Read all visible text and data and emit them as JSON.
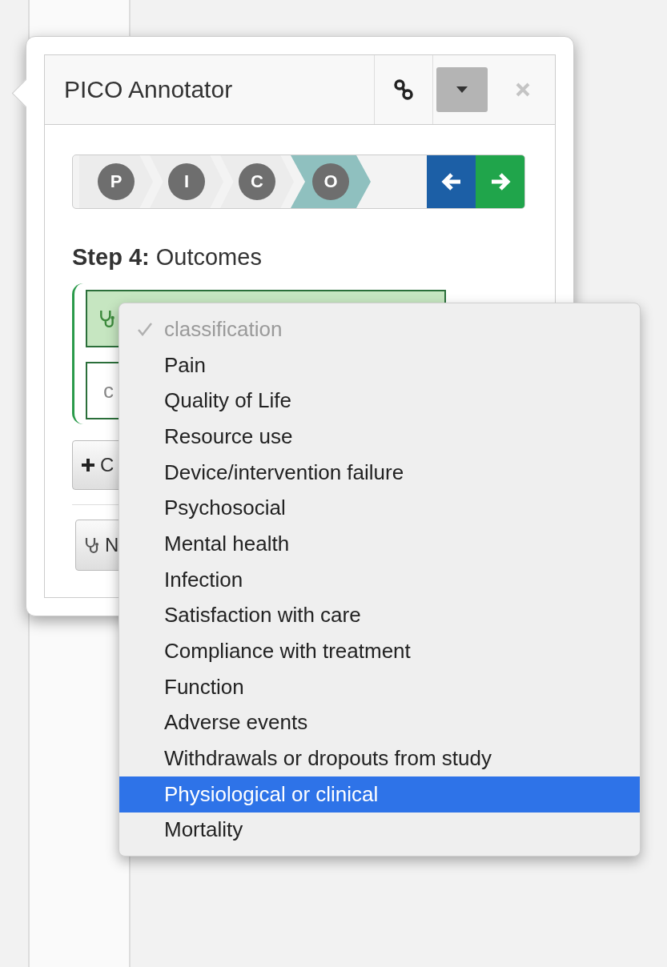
{
  "popover": {
    "title": "PICO Annotator",
    "steps": [
      {
        "label": "P",
        "selected": false
      },
      {
        "label": "I",
        "selected": false
      },
      {
        "label": "C",
        "selected": false
      },
      {
        "label": "O",
        "selected": true
      }
    ],
    "step_heading": "**Step 4:** Outcomes",
    "outcomes": [
      {
        "selected": true
      },
      {
        "label": "c",
        "selected": false
      }
    ],
    "add_button": "C",
    "bottom_button": "N"
  },
  "menu": {
    "items": [
      {
        "label": "classification",
        "checked": true,
        "disabled": true,
        "selected": false
      },
      {
        "label": "Pain",
        "checked": false,
        "disabled": false,
        "selected": false
      },
      {
        "label": "Quality of Life",
        "checked": false,
        "disabled": false,
        "selected": false
      },
      {
        "label": "Resource use",
        "checked": false,
        "disabled": false,
        "selected": false
      },
      {
        "label": "Device/intervention failure",
        "checked": false,
        "disabled": false,
        "selected": false
      },
      {
        "label": "Psychosocial",
        "checked": false,
        "disabled": false,
        "selected": false
      },
      {
        "label": "Mental health",
        "checked": false,
        "disabled": false,
        "selected": false
      },
      {
        "label": "Infection",
        "checked": false,
        "disabled": false,
        "selected": false
      },
      {
        "label": "Satisfaction with care",
        "checked": false,
        "disabled": false,
        "selected": false
      },
      {
        "label": "Compliance with treatment",
        "checked": false,
        "disabled": false,
        "selected": false
      },
      {
        "label": "Function",
        "checked": false,
        "disabled": false,
        "selected": false
      },
      {
        "label": "Adverse events",
        "checked": false,
        "disabled": false,
        "selected": false
      },
      {
        "label": "Withdrawals or dropouts from study",
        "checked": false,
        "disabled": false,
        "selected": false
      },
      {
        "label": "Physiological or clinical",
        "checked": false,
        "disabled": false,
        "selected": true
      },
      {
        "label": "Mortality",
        "checked": false,
        "disabled": false,
        "selected": false
      }
    ]
  }
}
